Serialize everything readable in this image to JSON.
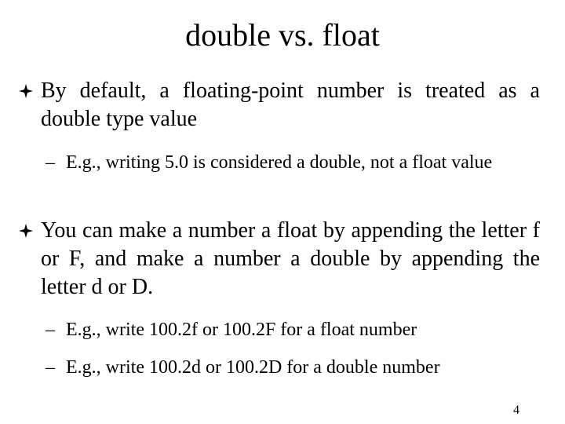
{
  "slide": {
    "title": "double vs. float",
    "bullets": [
      {
        "icon": "four-point-star-icon",
        "text": "By default, a floating-point number is treated as a double type value",
        "subs": [
          {
            "dash": "–",
            "text": "E.g., writing 5.0 is considered a double, not a float value"
          }
        ]
      },
      {
        "icon": "four-point-star-icon",
        "text": "You can make a number a float by appending the letter f or F, and make a number a double by appending the letter d or D.",
        "subs": [
          {
            "dash": "–",
            "text": "E.g., write 100.2f or 100.2F for a float number"
          },
          {
            "dash": "–",
            "text": "E.g., write 100.2d or 100.2D for a double number"
          }
        ]
      }
    ],
    "page_number": "4"
  }
}
